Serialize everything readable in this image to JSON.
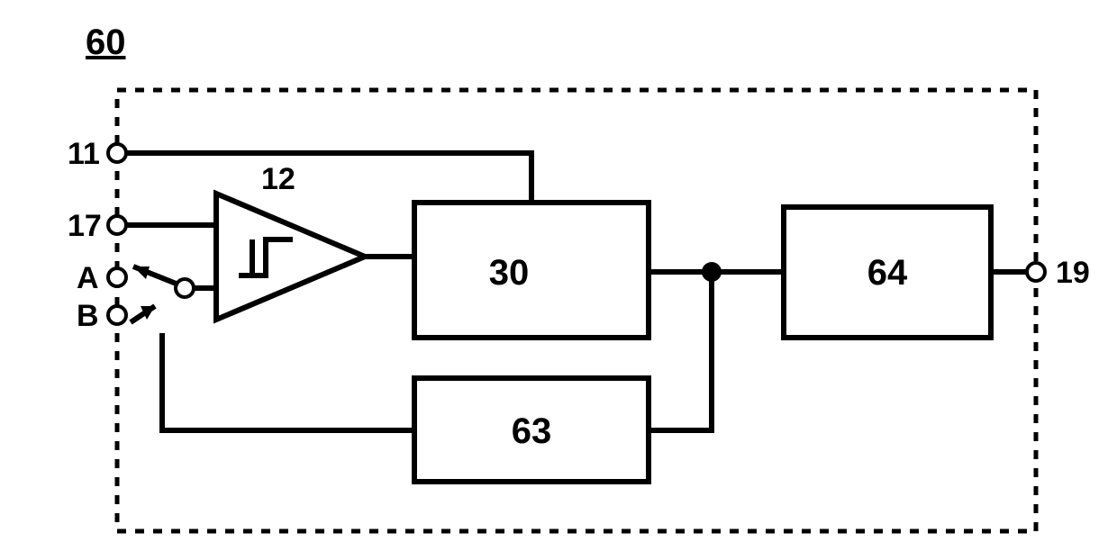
{
  "diagram": {
    "figure_number": "60",
    "boundary": {
      "label": "60",
      "style": "dashed"
    },
    "terminals": {
      "left": [
        {
          "id": "t11",
          "label": "11"
        },
        {
          "id": "t17",
          "label": "17"
        },
        {
          "id": "tA",
          "label": "A"
        },
        {
          "id": "tB",
          "label": "B"
        }
      ],
      "right": [
        {
          "id": "t19",
          "label": "19"
        }
      ]
    },
    "components": {
      "comparator": {
        "label": "12",
        "type": "schmitt-trigger-comparator",
        "inputs": [
          "17",
          "switch(A,B)"
        ],
        "output_to": "30"
      },
      "block30": {
        "label": "30",
        "inputs_from": [
          "11",
          "12"
        ],
        "output_node": "n1"
      },
      "block63": {
        "label": "63",
        "input_from": "n1",
        "output_to": "switch-control"
      },
      "block64": {
        "label": "64",
        "input_from": "n1",
        "output_to": "19"
      }
    },
    "nodes": {
      "n1": {
        "type": "junction",
        "connects": [
          "30.out",
          "63.in",
          "64.in"
        ]
      }
    },
    "switch": {
      "positions": [
        "A",
        "B"
      ],
      "wiper_connected_to": "A",
      "control_from": "63"
    }
  }
}
